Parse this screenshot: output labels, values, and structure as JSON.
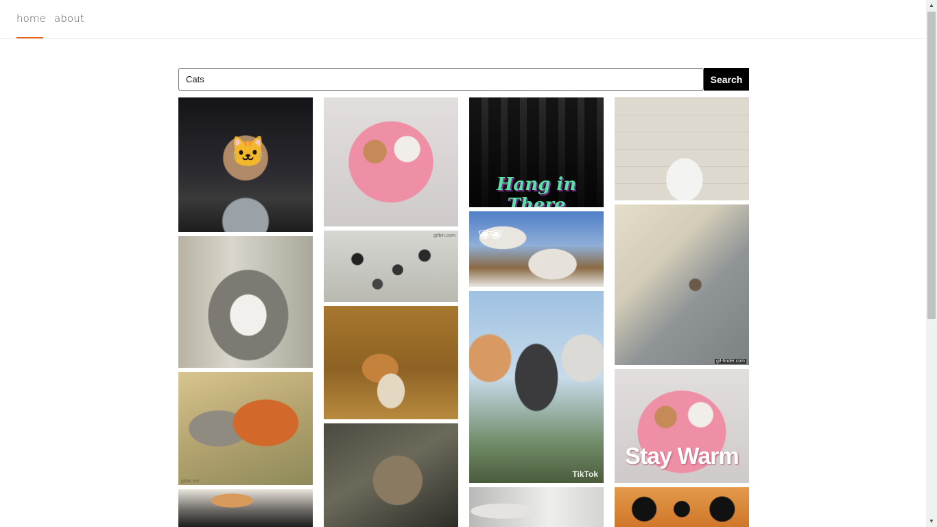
{
  "nav": {
    "home_label": "home",
    "about_label": "about",
    "active_color": "#e8641c"
  },
  "search": {
    "value": "Cats",
    "button_label": "Search"
  },
  "gifs": {
    "hang_in_there_caption": "Hang in There",
    "stay_warm_caption": "Stay Warm",
    "tiktok_watermark": "TikTok",
    "giffinder_watermark": "gif-finder.com",
    "gifbin_watermark": "gifbin.com",
    "gifak_watermark": "gifak.net"
  }
}
